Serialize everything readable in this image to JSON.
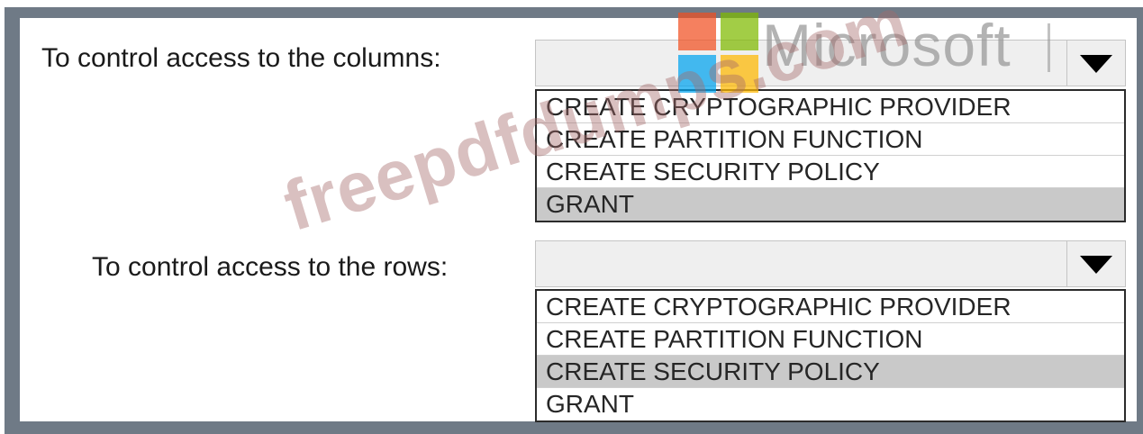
{
  "question_1": {
    "label": "To control access to the columns:",
    "selected_value": "",
    "options": [
      {
        "label": "CREATE CRYPTOGRAPHIC PROVIDER",
        "selected": false
      },
      {
        "label": "CREATE PARTITION FUNCTION",
        "selected": false
      },
      {
        "label": "CREATE SECURITY POLICY",
        "selected": false
      },
      {
        "label": "GRANT",
        "selected": true
      }
    ]
  },
  "question_2": {
    "label": "To control access to the rows:",
    "selected_value": "",
    "options": [
      {
        "label": "CREATE CRYPTOGRAPHIC PROVIDER",
        "selected": false
      },
      {
        "label": "CREATE PARTITION FUNCTION",
        "selected": false
      },
      {
        "label": "CREATE SECURITY POLICY",
        "selected": true
      },
      {
        "label": "GRANT",
        "selected": false
      }
    ]
  },
  "watermarks": {
    "brand_text": "Microsoft",
    "site_text": "freepdfdumps.com"
  },
  "colors": {
    "frame": "#6f7a86",
    "selected_option_bg": "#c9c9c9",
    "logo_red": "#f25022",
    "logo_green": "#7fba00",
    "logo_blue": "#00a4ef",
    "logo_yellow": "#ffb900"
  },
  "icons": {
    "dropdown_arrow": "triangle-down-icon",
    "brand_logo": "microsoft-logo-icon"
  }
}
